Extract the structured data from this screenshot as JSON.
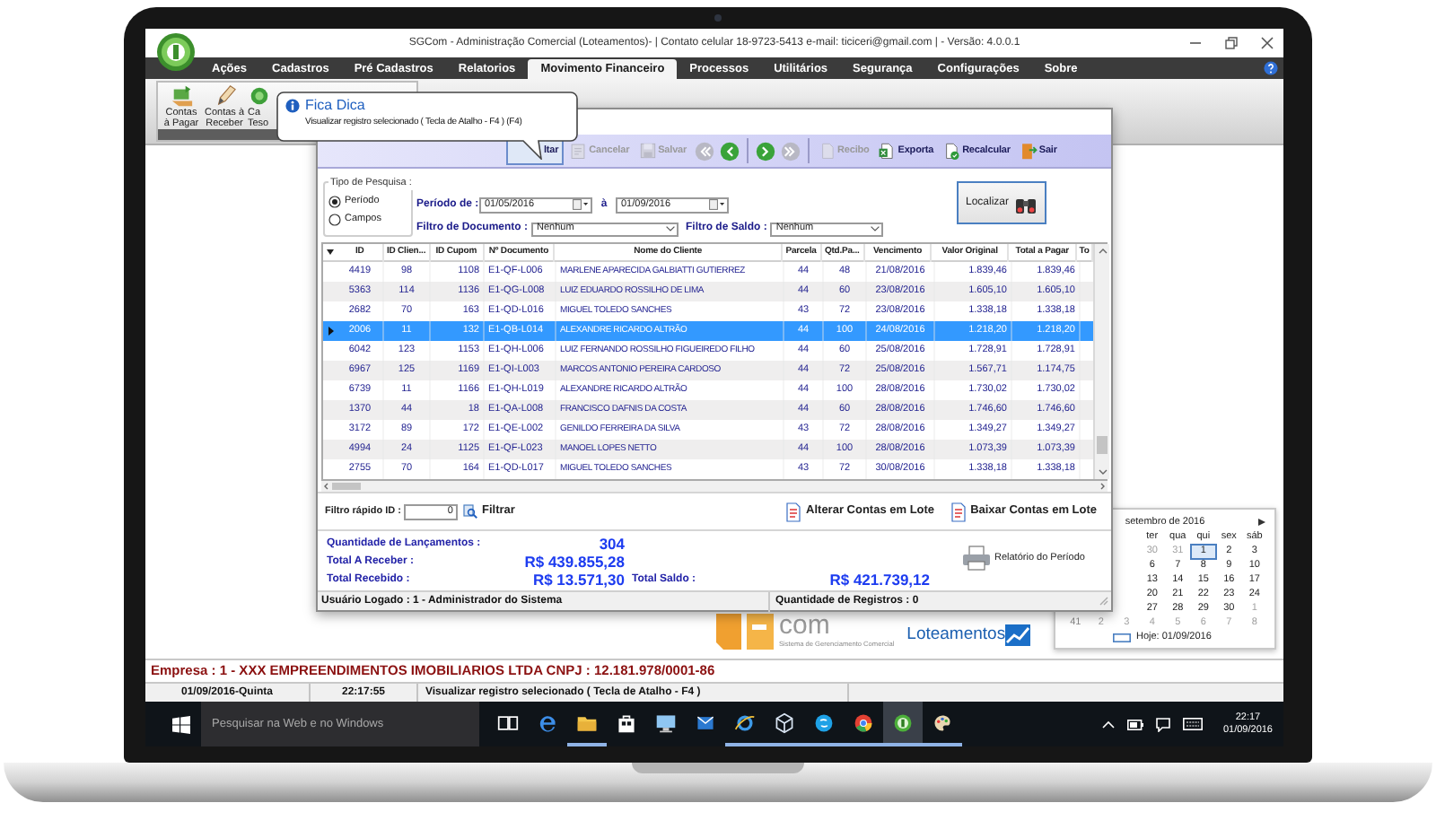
{
  "window": {
    "title": "SGCom - Administração Comercial (Loteamentos)- | Contato celular 18-9723-5413 e-mail: ticiceri@gmail.com | - Versão: 4.0.0.1"
  },
  "menu": [
    {
      "label": "Ações",
      "selected": false
    },
    {
      "label": "Cadastros",
      "selected": false
    },
    {
      "label": "Pré Cadastros",
      "selected": false
    },
    {
      "label": "Relatorios",
      "selected": false
    },
    {
      "label": "Movimento Financeiro",
      "selected": true
    },
    {
      "label": "Processos",
      "selected": false
    },
    {
      "label": "Utilitários",
      "selected": false
    },
    {
      "label": "Segurança",
      "selected": false
    },
    {
      "label": "Configurações",
      "selected": false
    },
    {
      "label": "Sobre",
      "selected": false
    }
  ],
  "ribbon": [
    {
      "lines": [
        "Contas",
        "à Pagar"
      ]
    },
    {
      "lines": [
        "Contas à",
        "Receber"
      ]
    },
    {
      "lines": [
        "Ca",
        "Teso"
      ]
    }
  ],
  "tooltip": {
    "title": "Fica Dica",
    "text": "Visualizar registro selecionado  ( Tecla de Atalho - F4 ) (F4)"
  },
  "form": {
    "toolbar": [
      {
        "kind": "button",
        "label": "ltar",
        "disabled": false,
        "pressed": true
      },
      {
        "kind": "button",
        "label": "Cancelar",
        "disabled": true,
        "pressed": false
      },
      {
        "kind": "button",
        "label": "Salvar",
        "disabled": true,
        "pressed": false
      },
      {
        "kind": "first",
        "disabled": true
      },
      {
        "kind": "prev",
        "disabled": false
      },
      {
        "kind": "next",
        "disabled": false
      },
      {
        "kind": "last",
        "disabled": true
      },
      {
        "kind": "button",
        "label": "Recibo",
        "disabled": true,
        "pressed": false
      },
      {
        "kind": "button",
        "label": "Exporta",
        "disabled": false,
        "pressed": false
      },
      {
        "kind": "button",
        "label": "Recalcular",
        "disabled": false,
        "pressed": false
      },
      {
        "kind": "button",
        "label": "Sair",
        "disabled": false,
        "pressed": false
      }
    ],
    "search": {
      "group_label": "Tipo de Pesquisa :",
      "options": [
        {
          "label": "Período",
          "selected": true
        },
        {
          "label": "Campos",
          "selected": false
        }
      ],
      "period_label": "Período de :",
      "date_from": "01/05/2016",
      "between": "à",
      "date_to": "01/09/2016",
      "doc_filter_label": "Filtro de Documento :",
      "doc_filter": "Nenhum",
      "balance_filter_label": "Filtro de Saldo :",
      "balance_filter": "Nenhum",
      "find_button": "Localizar"
    },
    "table": {
      "columns": [
        "ID",
        "ID Clien...",
        "ID Cupom",
        "Nº Documento",
        "Nome do Cliente",
        "Parcela",
        "Qtd.Pa...",
        "Vencimento",
        "Valor Original",
        "Total a Pagar",
        "To"
      ],
      "rows": [
        {
          "selected": false,
          "cells": [
            "4419",
            "98",
            "1108",
            "E1-QF-L006",
            "MARLENE APARECIDA GALBIATTI GUTIERREZ",
            "44",
            "48",
            "21/08/2016",
            "1.839,46",
            "1.839,46"
          ]
        },
        {
          "selected": false,
          "cells": [
            "5363",
            "114",
            "1136",
            "E1-QG-L008",
            "LUIZ EDUARDO ROSSILHO DE LIMA",
            "44",
            "60",
            "23/08/2016",
            "1.605,10",
            "1.605,10"
          ]
        },
        {
          "selected": false,
          "cells": [
            "2682",
            "70",
            "163",
            "E1-QD-L016",
            "MIGUEL TOLEDO SANCHES",
            "43",
            "72",
            "23/08/2016",
            "1.338,18",
            "1.338,18"
          ]
        },
        {
          "selected": true,
          "cells": [
            "2006",
            "11",
            "132",
            "E1-QB-L014",
            "ALEXANDRE RICARDO ALTRÃO",
            "44",
            "100",
            "24/08/2016",
            "1.218,20",
            "1.218,20"
          ]
        },
        {
          "selected": false,
          "cells": [
            "6042",
            "123",
            "1153",
            "E1-QH-L006",
            "LUIZ FERNANDO ROSSILHO FIGUEIREDO FILHO",
            "44",
            "60",
            "25/08/2016",
            "1.728,91",
            "1.728,91"
          ]
        },
        {
          "selected": false,
          "cells": [
            "6967",
            "125",
            "1169",
            "E1-QI-L003",
            "MARCOS ANTONIO PEREIRA CARDOSO",
            "44",
            "72",
            "25/08/2016",
            "1.567,71",
            "1.174,75"
          ]
        },
        {
          "selected": false,
          "cells": [
            "6739",
            "11",
            "1166",
            "E1-QH-L019",
            "ALEXANDRE RICARDO ALTRÃO",
            "44",
            "100",
            "28/08/2016",
            "1.730,02",
            "1.730,02"
          ]
        },
        {
          "selected": false,
          "cells": [
            "1370",
            "44",
            "18",
            "E1-QA-L008",
            "FRANCISCO DAFNIS DA COSTA",
            "44",
            "60",
            "28/08/2016",
            "1.746,60",
            "1.746,60"
          ]
        },
        {
          "selected": false,
          "cells": [
            "3172",
            "89",
            "172",
            "E1-QE-L002",
            "GENILDO FERREIRA DA SILVA",
            "43",
            "72",
            "28/08/2016",
            "1.349,27",
            "1.349,27"
          ]
        },
        {
          "selected": false,
          "cells": [
            "4994",
            "24",
            "1125",
            "E1-QF-L023",
            "MANOEL LOPES NETTO",
            "44",
            "100",
            "28/08/2016",
            "1.073,39",
            "1.073,39"
          ]
        },
        {
          "selected": false,
          "cells": [
            "2755",
            "70",
            "164",
            "E1-QD-L017",
            "MIGUEL TOLEDO SANCHES",
            "43",
            "72",
            "30/08/2016",
            "1.338,18",
            "1.338,18"
          ]
        }
      ]
    },
    "quick_filter": {
      "label": "Filtro rápido ID :",
      "value": "0",
      "button": "Filtrar"
    },
    "batch_buttons": [
      "Alterar Contas em Lote",
      "Baixar Contas em Lote"
    ],
    "totals": {
      "count_label": "Quantidade de Lançamentos :",
      "count": "304",
      "receivable_label": "Total A Receber :",
      "receivable": "R$ 439.855,28",
      "received_label": "Total Recebido :",
      "received": "R$ 13.571,30",
      "balance_label": "Total Saldo :",
      "balance": "R$ 421.739,12"
    },
    "report_button": "Relatório do Período",
    "form_status": [
      "Usuário Logado : 1 - Administrador do Sistema",
      "Quantidade de Registros : 0"
    ]
  },
  "backdrop": {
    "logo_text": "com",
    "logo_tagline": "Sistema de Gerenciamento Comercial",
    "logo2_text": "Loteamentos"
  },
  "calendar": {
    "month": "setembro de 2016",
    "weekdays": [
      "ter",
      "qua",
      "qui",
      "sex",
      "sáb"
    ],
    "weeks": [
      {
        "days": [
          {
            "day": "30",
            "muted": true,
            "selected": false
          },
          {
            "day": "31",
            "muted": true,
            "selected": false
          },
          {
            "day": "1",
            "muted": false,
            "selected": true
          },
          {
            "day": "2",
            "muted": false,
            "selected": false
          },
          {
            "day": "3",
            "muted": false,
            "selected": false
          }
        ]
      },
      {
        "days": [
          {
            "day": "6",
            "muted": false,
            "selected": false
          },
          {
            "day": "7",
            "muted": false,
            "selected": false
          },
          {
            "day": "8",
            "muted": false,
            "selected": false
          },
          {
            "day": "9",
            "muted": false,
            "selected": false
          },
          {
            "day": "10",
            "muted": false,
            "selected": false
          }
        ]
      },
      {
        "days": [
          {
            "day": "13",
            "muted": false,
            "selected": false
          },
          {
            "day": "14",
            "muted": false,
            "selected": false
          },
          {
            "day": "15",
            "muted": false,
            "selected": false
          },
          {
            "day": "16",
            "muted": false,
            "selected": false
          },
          {
            "day": "17",
            "muted": false,
            "selected": false
          }
        ]
      },
      {
        "days": [
          {
            "day": "20",
            "muted": false,
            "selected": false
          },
          {
            "day": "21",
            "muted": false,
            "selected": false
          },
          {
            "day": "22",
            "muted": false,
            "selected": false
          },
          {
            "day": "23",
            "muted": false,
            "selected": false
          },
          {
            "day": "24",
            "muted": false,
            "selected": false
          }
        ]
      },
      {
        "days": [
          {
            "day": "27",
            "muted": false,
            "selected": false
          },
          {
            "day": "28",
            "muted": false,
            "selected": false
          },
          {
            "day": "29",
            "muted": false,
            "selected": false
          },
          {
            "day": "30",
            "muted": false,
            "selected": false
          },
          {
            "day": "1",
            "muted": true,
            "selected": false
          }
        ]
      },
      {
        "week": "41",
        "days": [
          {
            "day": "2",
            "muted": true,
            "selected": false
          },
          {
            "day": "3",
            "muted": true,
            "selected": false
          },
          {
            "day": "4",
            "muted": true,
            "selected": false
          },
          {
            "day": "5",
            "muted": true,
            "selected": false
          },
          {
            "day": "6",
            "muted": true,
            "selected": false
          },
          {
            "day": "7",
            "muted": true,
            "selected": false
          },
          {
            "day": "8",
            "muted": true,
            "selected": false
          }
        ]
      }
    ],
    "today": "Hoje: 01/09/2016"
  },
  "company": "Empresa : 1 - XXX EMPREENDIMENTOS IMOBILIARIOS LTDA  CNPJ : 12.181.978/0001-86",
  "status_bar": [
    "01/09/2016-Quinta",
    "22:17:55",
    "Visualizar registro selecionado  ( Tecla de Atalho - F4 )"
  ],
  "taskbar": {
    "search_placeholder": "Pesquisar na Web e no Windows",
    "apps": [
      {
        "running": false,
        "active": false
      },
      {
        "running": false,
        "active": false
      },
      {
        "running": true,
        "active": false
      },
      {
        "running": false,
        "active": false
      },
      {
        "running": false,
        "active": false
      },
      {
        "running": false,
        "active": false
      },
      {
        "running": true,
        "active": false
      },
      {
        "running": true,
        "active": false
      },
      {
        "running": true,
        "active": false
      },
      {
        "running": true,
        "active": false
      },
      {
        "running": true,
        "active": true
      },
      {
        "running": true,
        "active": false
      }
    ],
    "time": "22:17",
    "date": "01/09/2016"
  }
}
